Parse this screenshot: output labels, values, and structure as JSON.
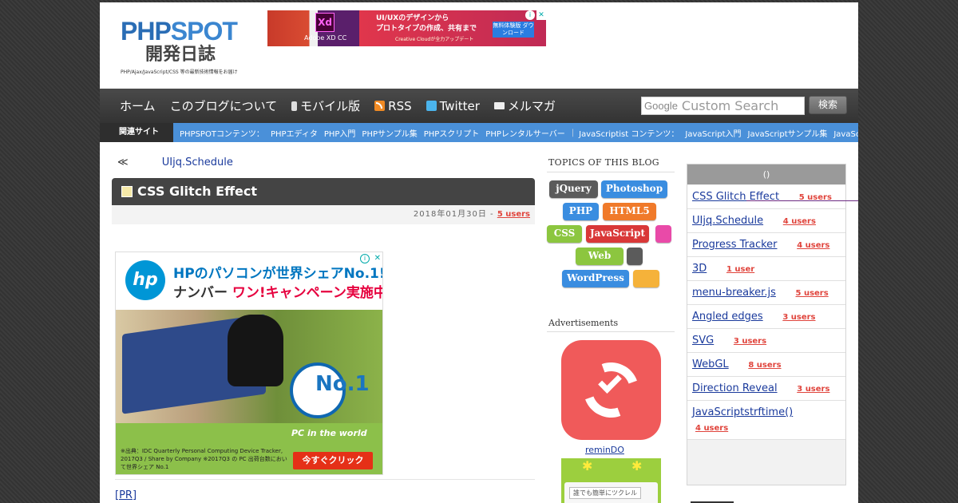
{
  "header": {
    "logo_main_a": "PHP",
    "logo_main_b": "SPOT",
    "logo_sub": "開発日誌",
    "logo_tag": "PHP/Ajax/JavaScript/CSS 等の最新技術情報をお届け",
    "top_ad": {
      "xd": "Xd",
      "product": "Adobe XD CC",
      "line1": "UI/UXのデザインから",
      "line2": "プロトタイプの作成、共有まで",
      "small": "Creative Cloudが全力アップデート",
      "button": "無料体験版 ダウンロード"
    }
  },
  "nav": {
    "items": [
      {
        "label": "ホーム",
        "icon": ""
      },
      {
        "label": "このブログについて",
        "icon": ""
      },
      {
        "label": "モバイル版",
        "icon": "mobile-icon"
      },
      {
        "label": "RSS",
        "icon": "rss-icon"
      },
      {
        "label": "Twitter",
        "icon": "twitter-icon"
      },
      {
        "label": "メルマガ",
        "icon": "mail-icon"
      }
    ],
    "search_brand": "Google",
    "search_placeholder": "Custom Search",
    "search_button": "検索"
  },
  "subnav": {
    "label": "関連サイト",
    "php_heading": "PHPSPOTコンテンツ：",
    "php_links": [
      "PHPエディタ",
      "PHP入門",
      "PHPサンプル集",
      "PHPスクリプト",
      "PHPレンタルサーバー"
    ],
    "js_heading": "JavaScriptist コンテンツ：",
    "js_links": [
      "JavaScript入門",
      "JavaScriptサンプル集",
      "JavaScriptリファレンス"
    ]
  },
  "post": {
    "prev_symbol": "≪",
    "prev_link": "UIjq.Schedule",
    "title": "CSS Glitch Effect",
    "date": "2018年01月30日",
    "meta_sep": "-",
    "users": "5 users",
    "pr": "[PR]"
  },
  "hp_ad": {
    "logo": "hp",
    "line1": "HPのパソコンが世界シェアNo.1!",
    "line2a": "ナンバー ",
    "line2b": "ワン!キャンペーン実施中",
    "no1": "No.1",
    "pc_world": "PC in the world",
    "note": "※出典：IDC Quarterly Personal Computing Device Tracker, 2017Q3 / Share by Company ※2017Q3 の PC 出荷台数において世界シェア No.1",
    "cta": "今すぐクリック"
  },
  "topics": {
    "title": "TOPICS OF THIS BLOG",
    "tags": [
      {
        "label": "jQuery",
        "color": "#5b5b5b"
      },
      {
        "label": "Photoshop",
        "color": "#3a8de0"
      },
      {
        "label": "PHP",
        "color": "#3a8de0"
      },
      {
        "label": "HTML5",
        "color": "#f07a2a"
      },
      {
        "label": "CSS",
        "color": "#8cc63f"
      },
      {
        "label": "JavaScript",
        "color": "#d93838"
      },
      {
        "label": "",
        "color": "#e94aa8"
      },
      {
        "label": "Web",
        "color": "#8cc63f"
      },
      {
        "label": "",
        "color": "#5b5b5b"
      },
      {
        "label": "WordPress",
        "color": "#3a8de0"
      },
      {
        "label": "",
        "color": "#f5b23a"
      }
    ]
  },
  "ads": {
    "title": "Advertisements",
    "app1_name": "reminDO",
    "app2_text": "誰でも簡単にツクレル"
  },
  "ranking": {
    "head": "()",
    "items": [
      {
        "title": "CSS Glitch Effect",
        "users": "5 users"
      },
      {
        "title": "UIjq.Schedule",
        "users": "4 users"
      },
      {
        "title": "Progress Tracker",
        "users": "4 users"
      },
      {
        "title": "3D",
        "users": "1 user"
      },
      {
        "title": "menu-breaker.js",
        "users": "5 users"
      },
      {
        "title": "Angled edges",
        "users": "3 users"
      },
      {
        "title": "SVG",
        "users": "3 users"
      },
      {
        "title": "WebGL",
        "users": "8 users"
      },
      {
        "title": "Direction Reveal",
        "users": "3 users"
      },
      {
        "title": "JavaScriptstrftime()",
        "users": "4 users"
      }
    ]
  }
}
